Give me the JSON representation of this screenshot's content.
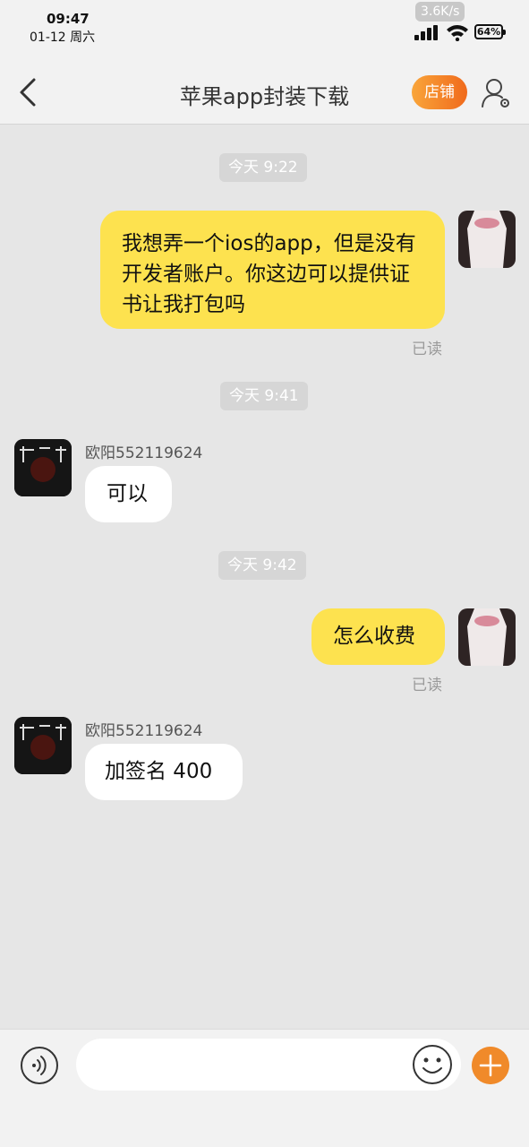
{
  "status_bar": {
    "time": "09:47",
    "date": "01-12 周六",
    "net_speed": "3.6K/s",
    "battery": "64%"
  },
  "nav": {
    "title": "苹果app封装下载",
    "shop_label": "店铺",
    "accent_color": "#f27a22"
  },
  "messages": {
    "ts1": "今天 9:22",
    "m1": "我想弄一个ios的app，但是没有开发者账户。你这边可以提供证书让我打包吗",
    "m1_read": "已读",
    "ts2": "今天 9:41",
    "sender1": "欧阳552119624",
    "m2": "可以",
    "ts3": "今天 9:42",
    "m3": "怎么收费",
    "m3_read": "已读",
    "sender2": "欧阳552119624",
    "m4": "加签名 400"
  },
  "input": {
    "placeholder": ""
  },
  "icons": [
    "back-chevron-icon",
    "user-settings-icon",
    "voice-icon",
    "emoji-icon",
    "plus-icon",
    "signal-icon",
    "wifi-icon"
  ]
}
